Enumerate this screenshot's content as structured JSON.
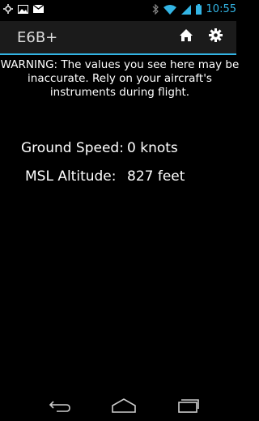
{
  "status_bar": {
    "time": "10:55",
    "left_icons": [
      "location-icon",
      "image-icon",
      "mail-icon"
    ],
    "right_icons": [
      "bluetooth-icon",
      "wifi-icon",
      "signal-icon",
      "battery-icon"
    ]
  },
  "action_bar": {
    "title": "E6B+",
    "actions": [
      "home-icon",
      "gear-icon"
    ]
  },
  "main": {
    "warning": "WARNING: The values you see here may be inaccurate. Rely on your aircraft's instruments during flight.",
    "ground_speed": {
      "label": "Ground Speed:",
      "value": "0 knots"
    },
    "msl_altitude": {
      "label": "MSL Altitude:",
      "value": "827 feet"
    }
  },
  "nav_bar": {
    "buttons": [
      "back-icon",
      "home-icon",
      "recent-apps-icon"
    ]
  },
  "colors": {
    "accent": "#33b5e5",
    "background": "#000000",
    "action_bar": "#1b1b1b"
  }
}
